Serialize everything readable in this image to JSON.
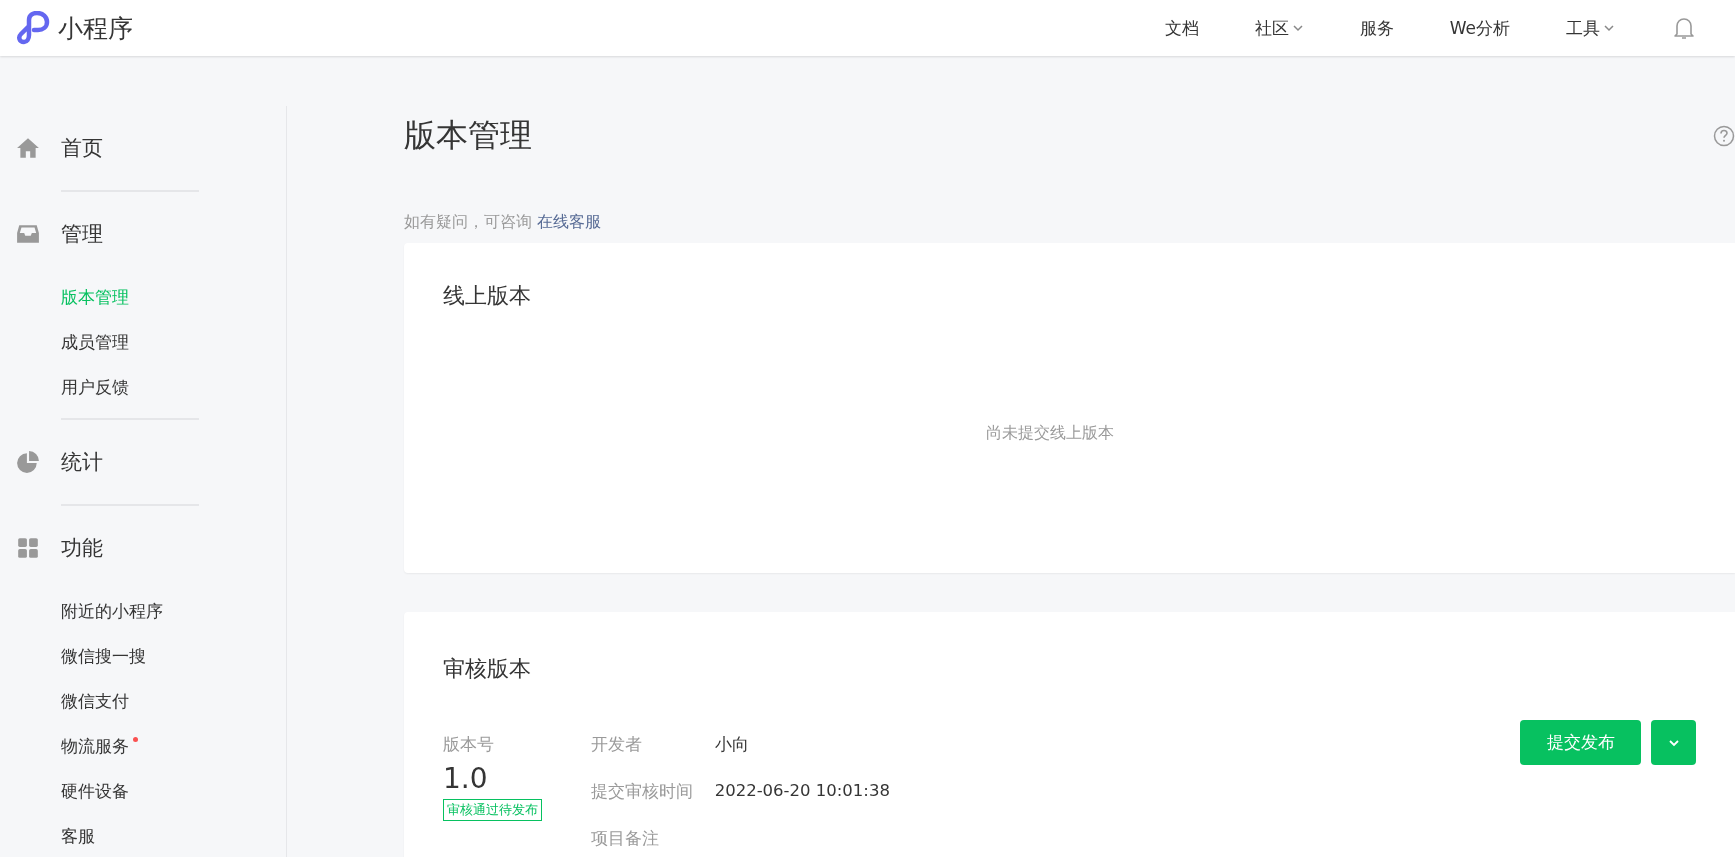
{
  "header": {
    "logo_text": "小程序",
    "nav": [
      {
        "label": "文档",
        "dropdown": false
      },
      {
        "label": "社区",
        "dropdown": true
      },
      {
        "label": "服务",
        "dropdown": false
      },
      {
        "label": "We分析",
        "dropdown": false
      },
      {
        "label": "工具",
        "dropdown": true
      }
    ]
  },
  "sidebar": {
    "sections": [
      {
        "label": "首页"
      },
      {
        "label": "管理",
        "children": [
          {
            "label": "版本管理",
            "selected": true,
            "dot": false
          },
          {
            "label": "成员管理",
            "selected": false,
            "dot": false
          },
          {
            "label": "用户反馈",
            "selected": false,
            "dot": false
          }
        ]
      },
      {
        "label": "统计"
      },
      {
        "label": "功能",
        "children": [
          {
            "label": "附近的小程序",
            "selected": false,
            "dot": false
          },
          {
            "label": "微信搜一搜",
            "selected": false,
            "dot": false
          },
          {
            "label": "微信支付",
            "selected": false,
            "dot": false
          },
          {
            "label": "物流服务",
            "selected": false,
            "dot": true
          },
          {
            "label": "硬件设备",
            "selected": false,
            "dot": false
          },
          {
            "label": "客服",
            "selected": false,
            "dot": false
          }
        ]
      }
    ]
  },
  "page": {
    "title": "版本管理",
    "help_text": "如有疑问，可咨询",
    "help_link": "在线客服"
  },
  "online_card": {
    "title": "线上版本",
    "empty_text": "尚未提交线上版本"
  },
  "review_card": {
    "title": "审核版本",
    "version_label": "版本号",
    "version": "1.0",
    "status": "审核通过待发布",
    "fields": [
      {
        "label": "开发者",
        "value": "小向"
      },
      {
        "label": "提交审核时间",
        "value": "2022-06-20 10:01:38"
      },
      {
        "label": "项目备注"
      }
    ],
    "submit_button": "提交发布"
  }
}
